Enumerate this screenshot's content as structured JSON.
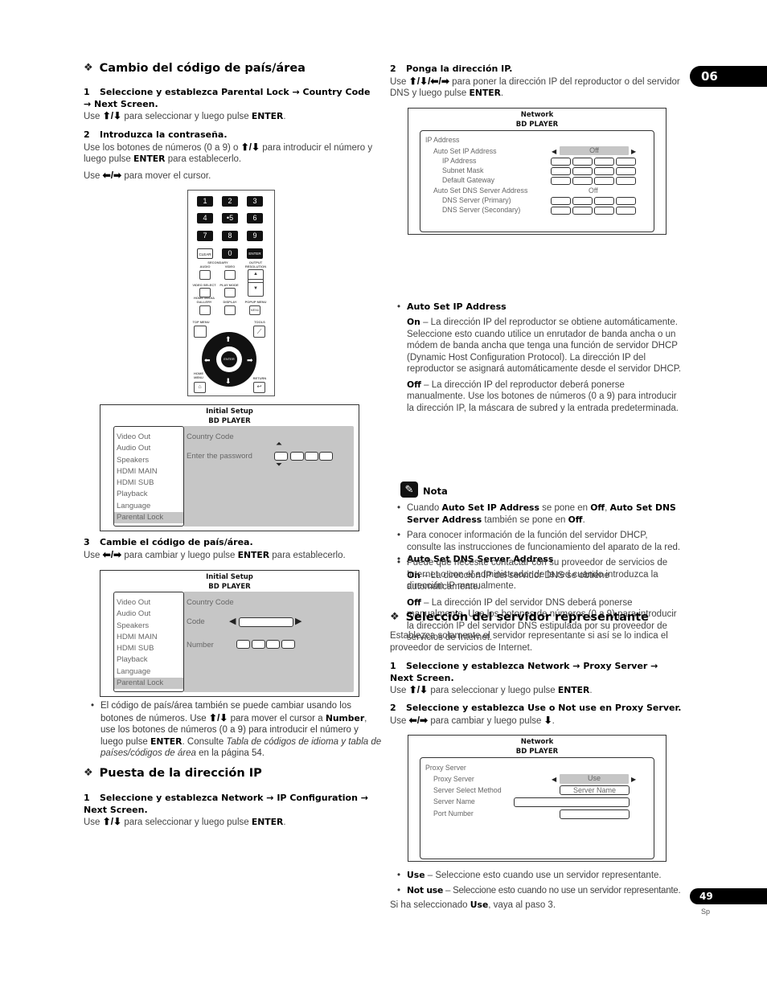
{
  "chapter_tab": "06",
  "page_number": "49",
  "page_lang": "Sp",
  "left": {
    "sec1": {
      "title": "Cambio del código de país/área",
      "step1": {
        "num": "1",
        "text": "Seleccione y establezca Parental Lock → Country Code → Next Screen.",
        "use": "Use",
        "keys": "⬆/⬇",
        "body": "para seleccionar y luego pulse",
        "enter": "ENTER",
        "end": "."
      },
      "step2": {
        "num": "2",
        "text": "Introduzca la contraseña.",
        "line1a": "Use los botones de números (0 a 9) o",
        "keys": "⬆/⬇",
        "line1b": "para introducir el número y luego pulse",
        "enter": "ENTER",
        "line1c": "para establecerlo.",
        "line2a": "Use",
        "keys2": "⬅/➡",
        "line2b": "para mover el cursor."
      },
      "step3": {
        "num": "3",
        "text": "Cambie el código de país/área.",
        "use": "Use",
        "keys": "⬅/➡",
        "body": "para cambiar y luego pulse",
        "enter": "ENTER",
        "end": "para establecerlo."
      },
      "note": {
        "a": "El código de país/área también se puede cambiar usando los botones de números. Use",
        "keys": "⬆/⬇",
        "b": "para mover el cursor a",
        "number": "Number",
        "c": ", use los botones de números (0 a 9) para introducir el número y luego pulse",
        "enter": "ENTER",
        "d": ". Consulte",
        "ref": "Tabla de códigos de idioma y tabla de países/códigos de área",
        "e": "en la página 54."
      }
    },
    "remote": {
      "keys": [
        "1",
        "2",
        "3",
        "4",
        "•5",
        "6",
        "7",
        "8",
        "9"
      ],
      "clear": "CLEAR",
      "zero": "0",
      "enter": "ENTER",
      "secondary": "SECONDARY",
      "audio": "AUDIO",
      "video": "VIDEO",
      "output_resolution": "OUTPUT RESOLUTION",
      "video_select": "VIDEO SELECT",
      "play_mode": "PLAY MODE",
      "home_media_gallery": "HOME MEDIA GALLERY",
      "display": "DISPLAY",
      "popup_menu": "POPUP MENU",
      "menu": "MENU",
      "top_menu": "TOP MENU",
      "tools": "TOOLS",
      "home_menu": "HOME MENU",
      "return": "RETURN",
      "pad_enter": "ENTER"
    },
    "screen1": {
      "title": "Initial Setup",
      "subtitle": "BD PLAYER",
      "menu": [
        "Video Out",
        "Audio Out",
        "Speakers",
        "HDMI MAIN",
        "HDMI SUB",
        "Playback",
        "Language",
        "Parental Lock"
      ],
      "selected": "Parental Lock",
      "heading": "Country Code",
      "password_label": "Enter the password"
    },
    "screen2": {
      "title": "Initial Setup",
      "subtitle": "BD PLAYER",
      "menu": [
        "Video Out",
        "Audio Out",
        "Speakers",
        "HDMI MAIN",
        "HDMI SUB",
        "Playback",
        "Language",
        "Parental Lock"
      ],
      "selected": "Parental Lock",
      "heading": "Country Code",
      "code_label": "Code",
      "number_label": "Number"
    },
    "sec2": {
      "title": "Puesta de la dirección IP",
      "step1": {
        "num": "1",
        "text": "Seleccione y establezca Network → IP Configuration → Next Screen.",
        "use": "Use",
        "keys": "⬆/⬇",
        "body": "para seleccionar y luego pulse",
        "enter": "ENTER",
        "end": "."
      }
    }
  },
  "right": {
    "step2": {
      "num": "2",
      "text": "Ponga la dirección IP.",
      "use": "Use",
      "keys": "⬆/⬇/⬅/➡",
      "body": "para poner la dirección IP del reproductor o del servidor DNS y luego pulse",
      "enter": "ENTER",
      "end": "."
    },
    "net_screen": {
      "title": "Network",
      "subtitle": "BD PLAYER",
      "group": "IP Address",
      "auto_ip": "Auto Set IP Address",
      "auto_ip_value": "Off",
      "ip": "IP Address",
      "subnet": "Subnet Mask",
      "gateway": "Default Gateway",
      "auto_dns": "Auto Set DNS Server Address",
      "auto_dns_value": "Off",
      "dns1": "DNS Server (Primary)",
      "dns2": "DNS Server (Secondary)"
    },
    "auto_ip_bullet": {
      "title": "Auto Set IP Address",
      "on": "On",
      "on_text": "– La dirección IP del reproductor se obtiene automáticamente. Seleccione esto cuando utilice un enrutador de banda ancha o un módem de banda ancha que tenga una función de servidor DHCP (Dynamic Host Configuration Protocol). La dirección IP del reproductor se asignará automáticamente desde el servidor DHCP.",
      "off": "Off",
      "off_text": "– La dirección IP del reproductor deberá ponerse manualmente. Use los botones de números (0 a 9) para introducir la dirección IP, la máscara de subred y la entrada predeterminada."
    },
    "auto_dns_bullet": {
      "title": "Auto Set DNS Server Address",
      "on": "On",
      "on_text": "– La dirección IP del servidor DNS se obtiene automáticamente.",
      "off": "Off",
      "off_text": "– La dirección IP del servidor DNS deberá ponerse manualmente. Use los botones de números (0 a 9) para introducir la dirección IP del servidor DNS estipulada por su proveedor de servicios de Internet."
    },
    "nota": {
      "title": "Nota",
      "n1": {
        "a": "Cuando",
        "b1": "Auto Set IP Address",
        "c": "se pone en",
        "b2": "Off",
        "d": ",",
        "b3": "Auto Set DNS Server Address",
        "e": "también se pone en",
        "b4": "Off",
        "f": "."
      },
      "n2": "Para conocer información de la función del servidor DHCP, consulte las instrucciones de funcionamiento del aparato de la red.",
      "n3": "Puede que necesite contactar con su proveedor de servicios de Internet o con el administrador de la red cuando introduzca la dirección IP manualmente."
    },
    "sec3": {
      "title": "Selección del servidor representante",
      "intro": "Establezca solamente el servidor representante si así se lo indica el proveedor de servicios de Internet.",
      "step1": {
        "num": "1",
        "text": "Seleccione y establezca Network → Proxy Server → Next Screen.",
        "use": "Use",
        "keys": "⬆/⬇",
        "body": "para seleccionar y luego pulse",
        "enter": "ENTER",
        "end": "."
      },
      "step2": {
        "num": "2",
        "text": "Seleccione y establezca Use o Not use en Proxy Server.",
        "use": "Use",
        "keys": "⬅/➡",
        "body": "para cambiar y luego pulse",
        "keys2": "⬇",
        "end": "."
      }
    },
    "proxy_screen": {
      "title": "Network",
      "subtitle": "BD PLAYER",
      "group": "Proxy Server",
      "proxy": "Proxy Server",
      "proxy_value": "Use",
      "method": "Server Select Method",
      "method_value": "Server Name",
      "server_name": "Server Name",
      "port": "Port Number"
    },
    "use_bullet": {
      "b": "Use",
      "text": "– Seleccione esto cuando use un servidor representante."
    },
    "notuse_bullet": {
      "b": "Not use",
      "text": "– Seleccione esto cuando no use un servidor representante."
    },
    "final": {
      "a": "Si ha seleccionado",
      "b": "Use",
      "c": ", vaya al paso 3."
    }
  }
}
